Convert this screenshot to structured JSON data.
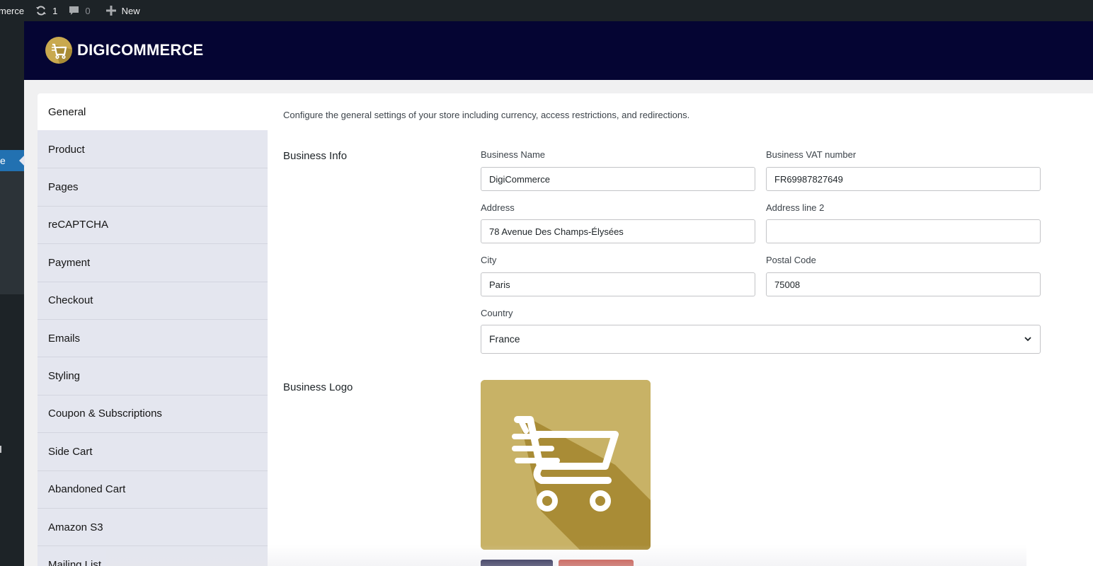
{
  "adminbar": {
    "site_label": "merce",
    "updates_count": "1",
    "comments_count": "0",
    "new_label": "New"
  },
  "wpmenu": {
    "current_label": "e"
  },
  "header": {
    "brand": "DIGICOMMERCE"
  },
  "tabs": [
    {
      "label": "General"
    },
    {
      "label": "Product"
    },
    {
      "label": "Pages"
    },
    {
      "label": "reCAPTCHA"
    },
    {
      "label": "Payment"
    },
    {
      "label": "Checkout"
    },
    {
      "label": "Emails"
    },
    {
      "label": "Styling"
    },
    {
      "label": "Coupon & Subscriptions"
    },
    {
      "label": "Side Cart"
    },
    {
      "label": "Abandoned Cart"
    },
    {
      "label": "Amazon S3"
    },
    {
      "label": "Mailing List"
    }
  ],
  "description": "Configure the general settings of your store including currency, access restrictions, and redirections.",
  "business_info": {
    "title": "Business Info",
    "business_name_label": "Business Name",
    "business_name_value": "DigiCommerce",
    "vat_label": "Business VAT number",
    "vat_value": "FR69987827649",
    "address_label": "Address",
    "address_value": "78 Avenue Des Champs-Élysées",
    "address2_label": "Address line 2",
    "address2_value": "",
    "city_label": "City",
    "city_value": "Paris",
    "postal_label": "Postal Code",
    "postal_value": "75008",
    "country_label": "Country",
    "country_value": "France"
  },
  "business_logo": {
    "title": "Business Logo"
  },
  "icons": {
    "updates": "refresh-icon",
    "comments": "comment-icon",
    "new": "plus-icon",
    "logo": "shopping-cart-icon",
    "select": "chevron-down-icon"
  },
  "colors": {
    "header_bg": "#050533",
    "logo_gold": "#c9a94f",
    "tab_bg": "#e4e6ef",
    "wp_blue": "#2271b1"
  }
}
